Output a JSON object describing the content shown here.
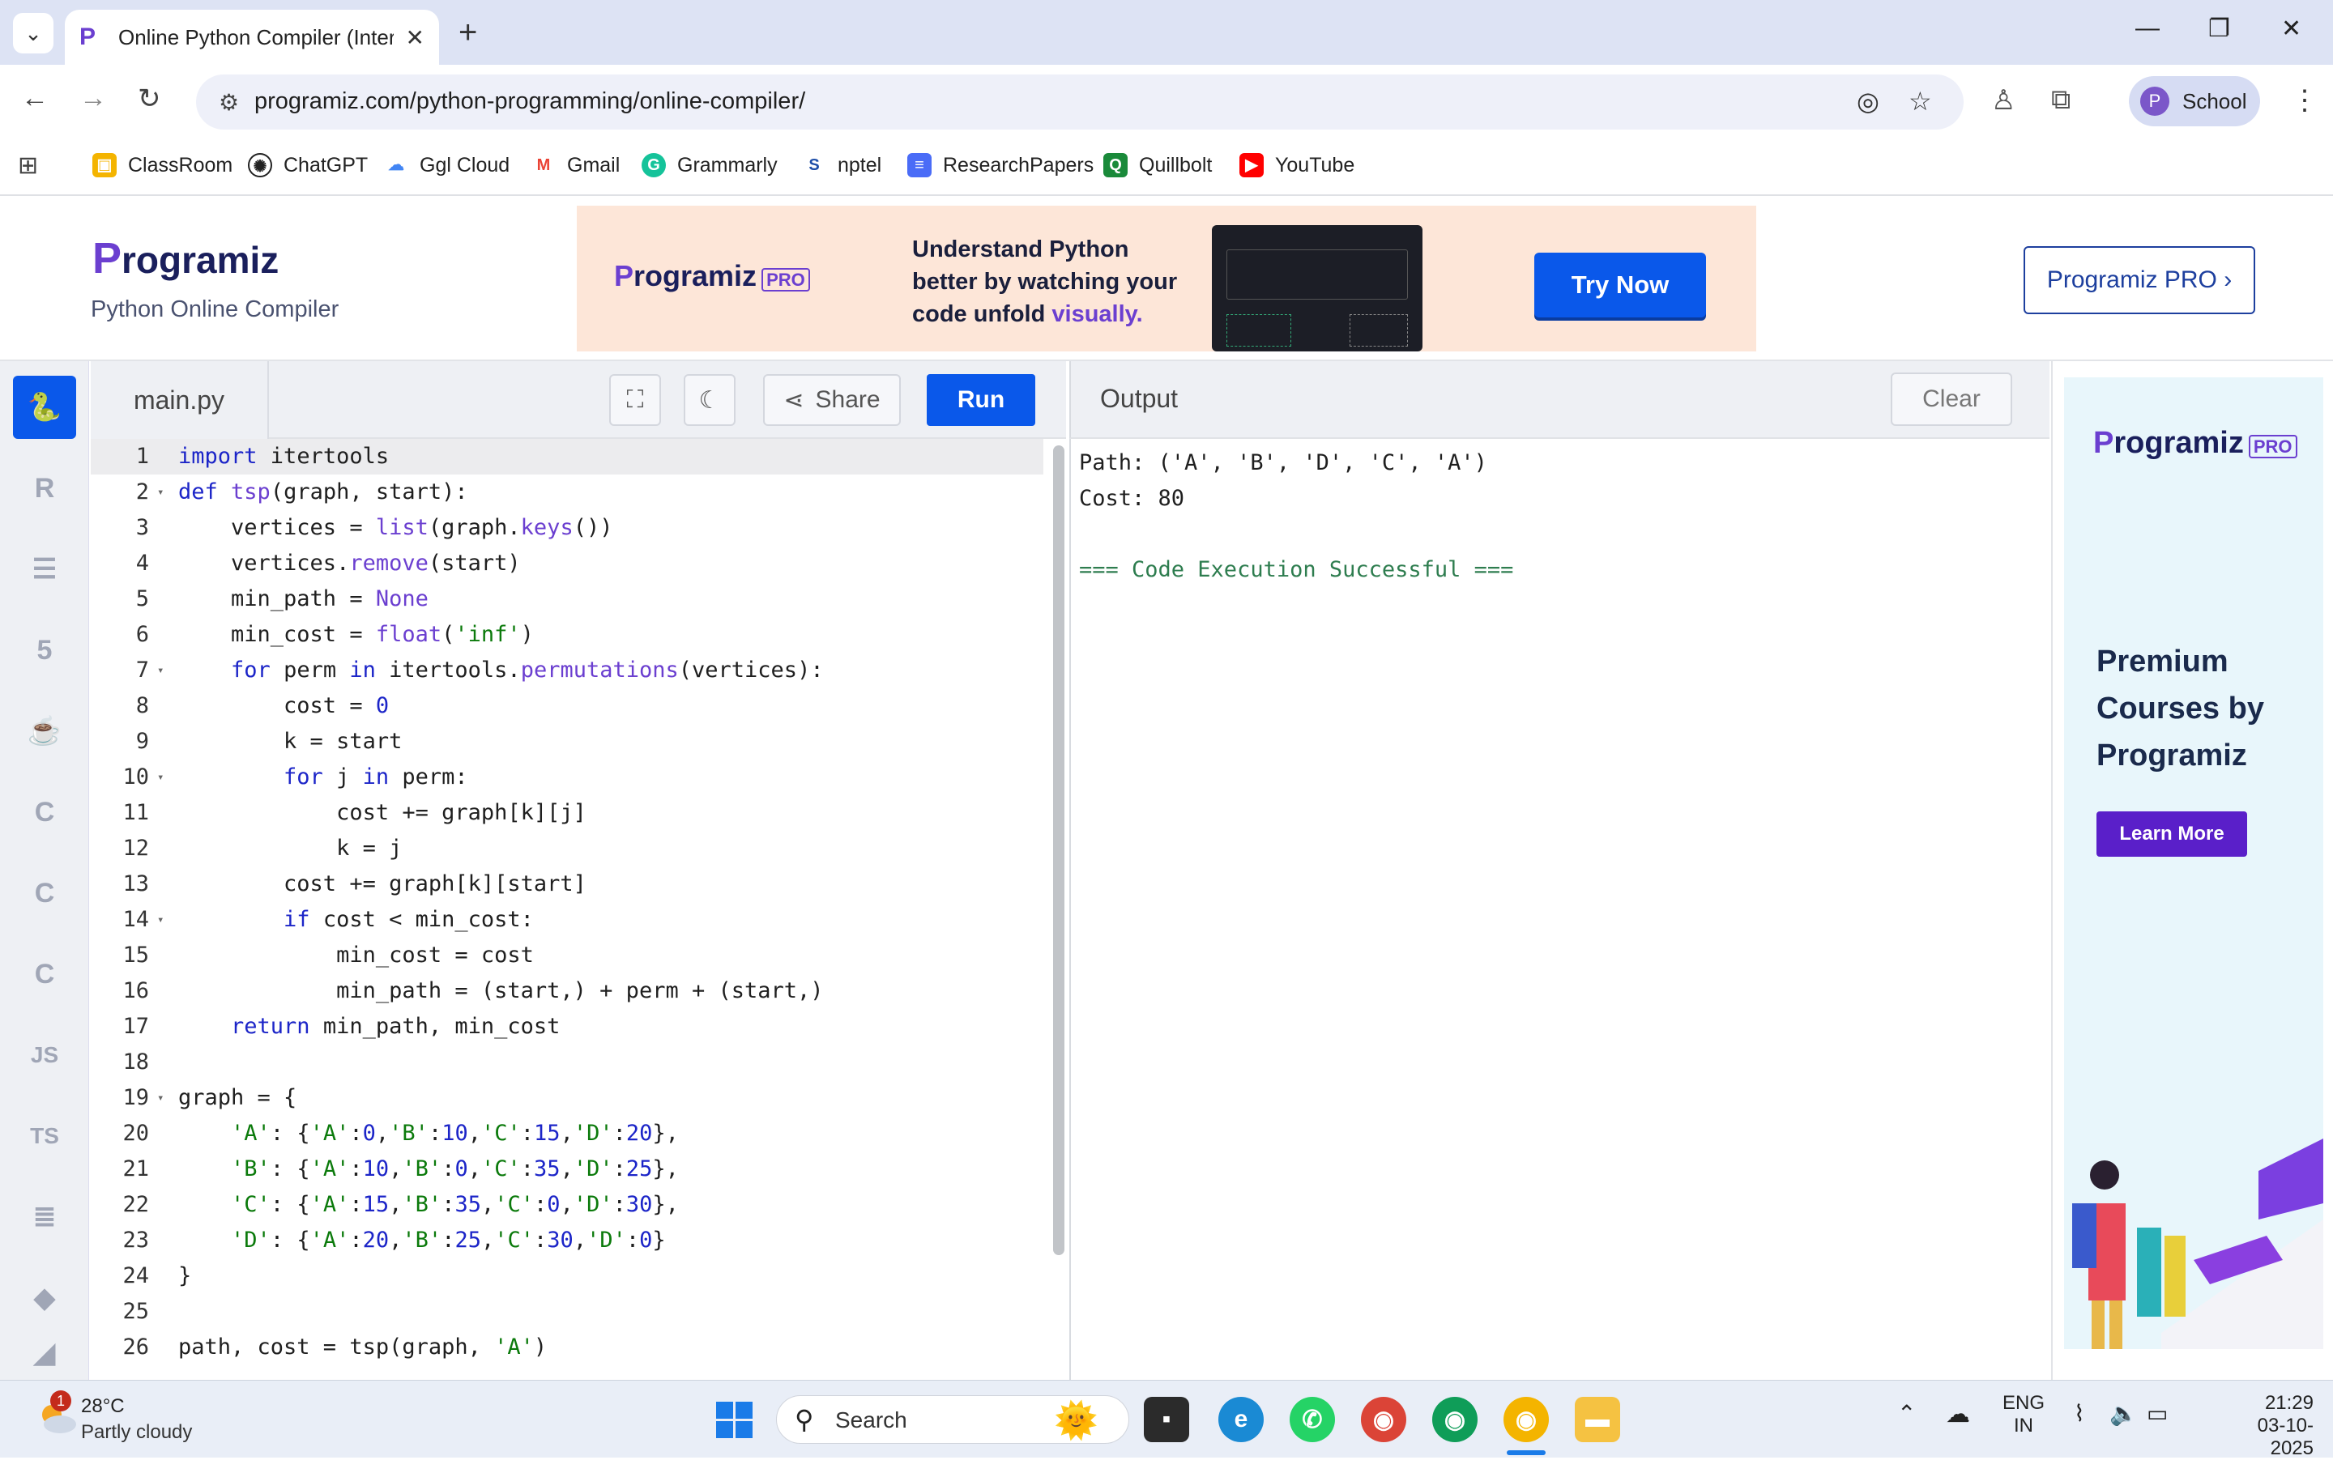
{
  "browser": {
    "tab_title": "Online Python Compiler (Interp",
    "url": "programiz.com/python-programming/online-compiler/",
    "profile_name": "School",
    "profile_initial": "P",
    "bookmarks": [
      "ClassRoom",
      "ChatGPT",
      "Ggl Cloud",
      "Gmail",
      "Grammarly",
      "nptel",
      "ResearchPapers",
      "Quillbolt",
      "YouTube"
    ]
  },
  "header": {
    "logo_text": "rogramiz",
    "logo_p": "P",
    "subtitle": "Python Online Compiler",
    "banner_logo": "rogramiz",
    "banner_pro": "PRO",
    "banner_line1": "Understand Python",
    "banner_line2": "better by watching your",
    "banner_line3": "code unfold",
    "banner_line3b": "visually.",
    "try_now": "Try Now",
    "pro_button": "Programiz PRO ›"
  },
  "rail": {
    "items": [
      "python",
      "R",
      "sql",
      "html",
      "java",
      "c",
      "c++",
      "c#",
      "JS",
      "TS",
      "go",
      "swift",
      "rust"
    ],
    "js_label": "JS",
    "ts_label": "TS"
  },
  "editor": {
    "filename": "main.py",
    "share_label": "Share",
    "run_label": "Run",
    "line_numbers": [
      "1",
      "2",
      "3",
      "4",
      "5",
      "6",
      "7",
      "8",
      "9",
      "10",
      "11",
      "12",
      "13",
      "14",
      "15",
      "16",
      "17",
      "18",
      "19",
      "20",
      "21",
      "22",
      "23",
      "24",
      "25",
      "26"
    ]
  },
  "output": {
    "title": "Output",
    "clear_label": "Clear",
    "line1": "Path: ('A', 'B', 'D', 'C', 'A')",
    "line2": "Cost: 80",
    "line3": "=== Code Execution Successful ==="
  },
  "ad": {
    "logo": "rogramiz",
    "pro": "PRO",
    "headline1": "Premium",
    "headline2": "Courses by",
    "headline3": "Programiz",
    "learn_more": "Learn More"
  },
  "taskbar": {
    "temp": "28°C",
    "weather": "Partly cloudy",
    "badge": "1",
    "search": "Search",
    "lang1": "ENG",
    "lang2": "IN",
    "time": "21:29",
    "date": "03-10-2025"
  },
  "colors": {
    "accent": "#0a58ea",
    "brand": "#6b3fd0",
    "keyword": "#1c25c8",
    "string": "#0b7a0b"
  }
}
